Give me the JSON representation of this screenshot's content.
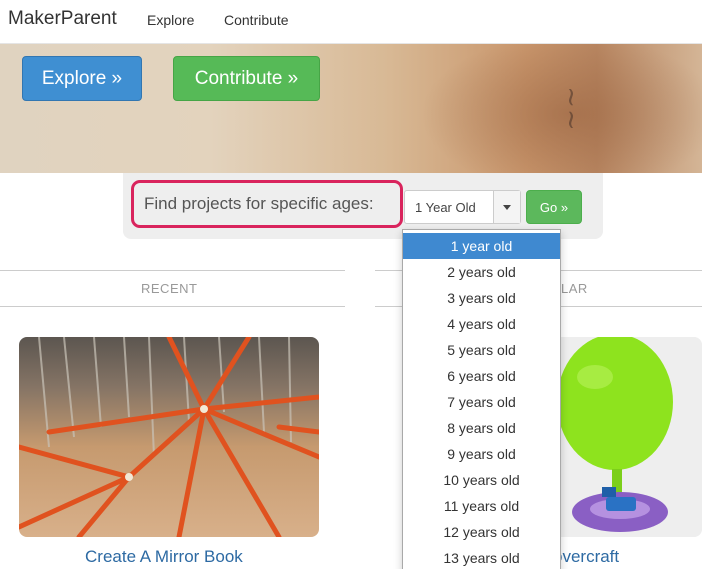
{
  "navbar": {
    "brand": "MakerParent",
    "links": [
      "Explore",
      "Contribute"
    ]
  },
  "hero": {
    "explore_label": "Explore »",
    "contribute_label": "Contribute »",
    "colors": {
      "explore": "#3f8fd2",
      "contribute": "#56ba57"
    }
  },
  "age_filter": {
    "label": "Find projects for specific ages:",
    "selected": "1 Year Old",
    "go_label": "Go »",
    "highlight_color": "#d9245d",
    "options": [
      "1 year old",
      "2 years old",
      "3 years old",
      "4 years old",
      "5 years old",
      "6 years old",
      "7 years old",
      "8 years old",
      "9 years old",
      "10 years old",
      "11 years old",
      "12 years old",
      "13 years old"
    ],
    "highlighted_option": "1 year old"
  },
  "sections": {
    "recent": "RECENT",
    "popular_visible": "LAR"
  },
  "cards": [
    {
      "title": "Create A Mirror Book"
    },
    {
      "title": "overcraft"
    }
  ]
}
